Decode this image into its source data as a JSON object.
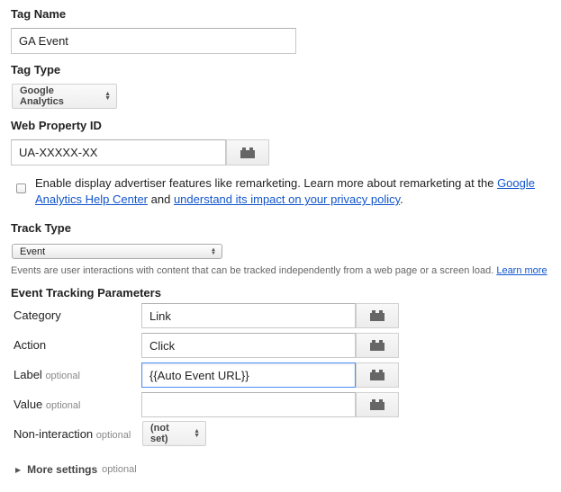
{
  "tag_name": {
    "label": "Tag Name",
    "value": "GA Event"
  },
  "tag_type": {
    "label": "Tag Type",
    "value": "Google Analytics"
  },
  "web_property": {
    "label": "Web Property ID",
    "value": "UA-XXXXX-XX"
  },
  "advertiser": {
    "text_line1": "Enable display advertiser features like remarketing. Learn more about remarketing at the",
    "link1_line1": "Google",
    "link1_line2": "Analytics Help Center",
    "and": "and",
    "link2": "understand its impact on your privacy policy",
    "period": ".",
    "checked": false
  },
  "track_type": {
    "label": "Track Type",
    "value": "Event",
    "help": "Events are user interactions with content that can be tracked independently from a web page or a screen load.",
    "help_link": "Learn more"
  },
  "event_params": {
    "heading": "Event Tracking Parameters",
    "category": {
      "label": "Category",
      "optional": "",
      "value": "Link"
    },
    "action": {
      "label": "Action",
      "optional": "",
      "value": "Click"
    },
    "label": {
      "label": "Label",
      "optional": "optional",
      "value": "{{Auto Event URL}}"
    },
    "value": {
      "label": "Value",
      "optional": "optional",
      "value": ""
    },
    "non_interaction": {
      "label": "Non-interaction",
      "optional": "optional",
      "value": "(not set)"
    }
  },
  "more_settings": {
    "label": "More settings",
    "optional": "optional"
  },
  "icons": {
    "macro": "macro-brick-icon",
    "updown": "updown-arrows-icon",
    "expand": "triangle-right-icon"
  },
  "colors": {
    "link": "#1155cc",
    "focus_border": "#4d90fe"
  }
}
